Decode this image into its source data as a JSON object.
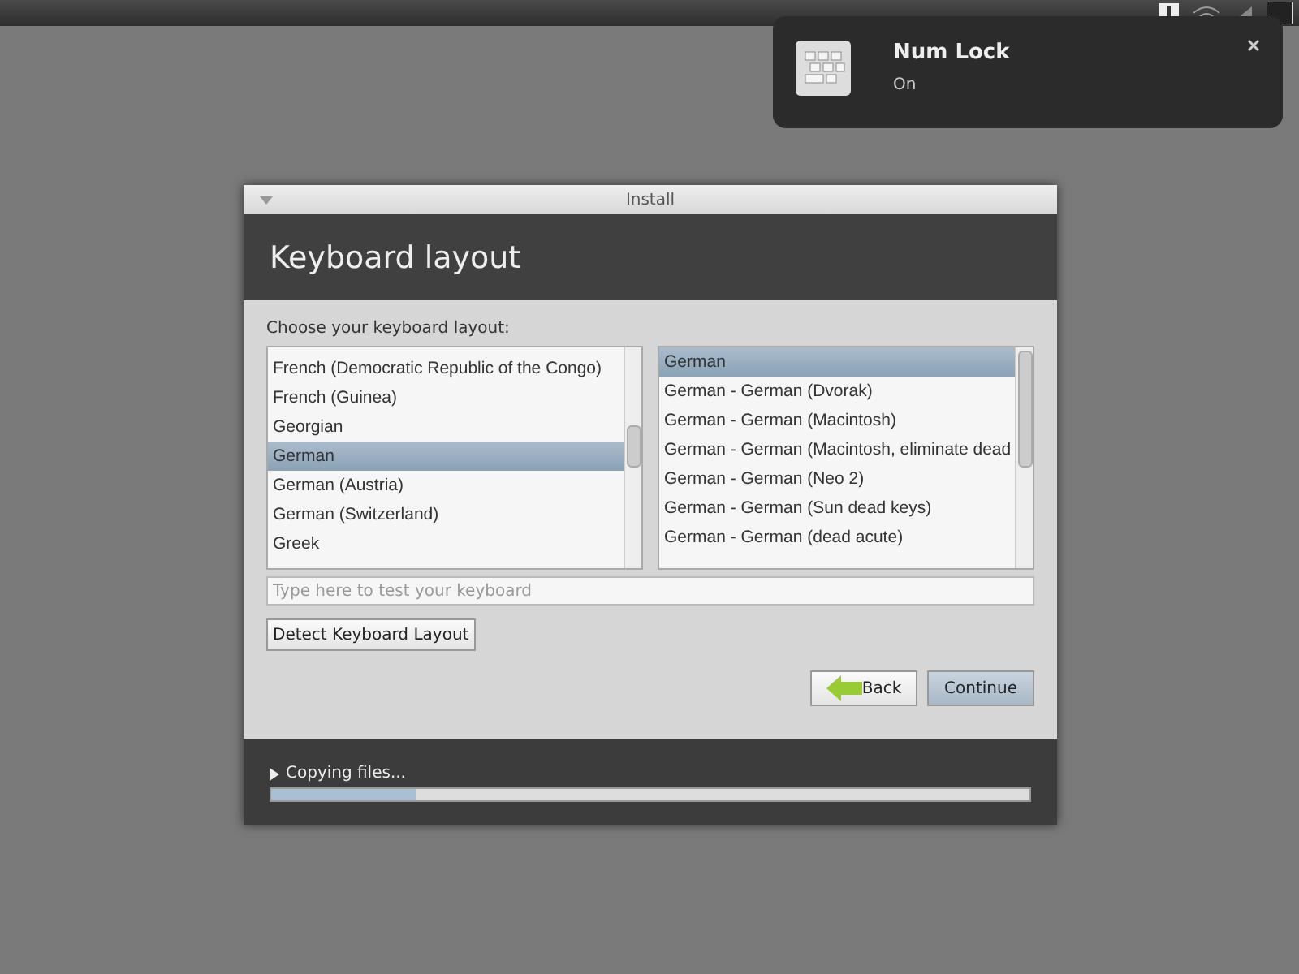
{
  "notification": {
    "title": "Num Lock",
    "body": "On"
  },
  "window": {
    "title": "Install"
  },
  "header": {
    "title": "Keyboard layout"
  },
  "prompt": "Choose your keyboard layout:",
  "layouts": [
    {
      "label": "French (Democratic Republic of the Congo)",
      "selected": false
    },
    {
      "label": "French (Guinea)",
      "selected": false
    },
    {
      "label": "Georgian",
      "selected": false
    },
    {
      "label": "German",
      "selected": true
    },
    {
      "label": "German (Austria)",
      "selected": false
    },
    {
      "label": "German (Switzerland)",
      "selected": false
    },
    {
      "label": "Greek",
      "selected": false
    }
  ],
  "variants": [
    {
      "label": "German",
      "selected": true
    },
    {
      "label": "German - German (Dvorak)",
      "selected": false
    },
    {
      "label": "German - German (Macintosh)",
      "selected": false
    },
    {
      "label": "German - German (Macintosh, eliminate dead",
      "selected": false
    },
    {
      "label": "German - German (Neo 2)",
      "selected": false
    },
    {
      "label": "German - German (Sun dead keys)",
      "selected": false
    },
    {
      "label": "German - German (dead acute)",
      "selected": false
    }
  ],
  "test_field": {
    "placeholder": "Type here to test your keyboard"
  },
  "detect_button": "Detect Keyboard Layout",
  "buttons": [
    {
      "label": "Back",
      "kind": "back"
    },
    {
      "label": "Continue",
      "kind": "primary"
    }
  ],
  "progress": {
    "label": "Copying files...",
    "level": 0.19
  }
}
